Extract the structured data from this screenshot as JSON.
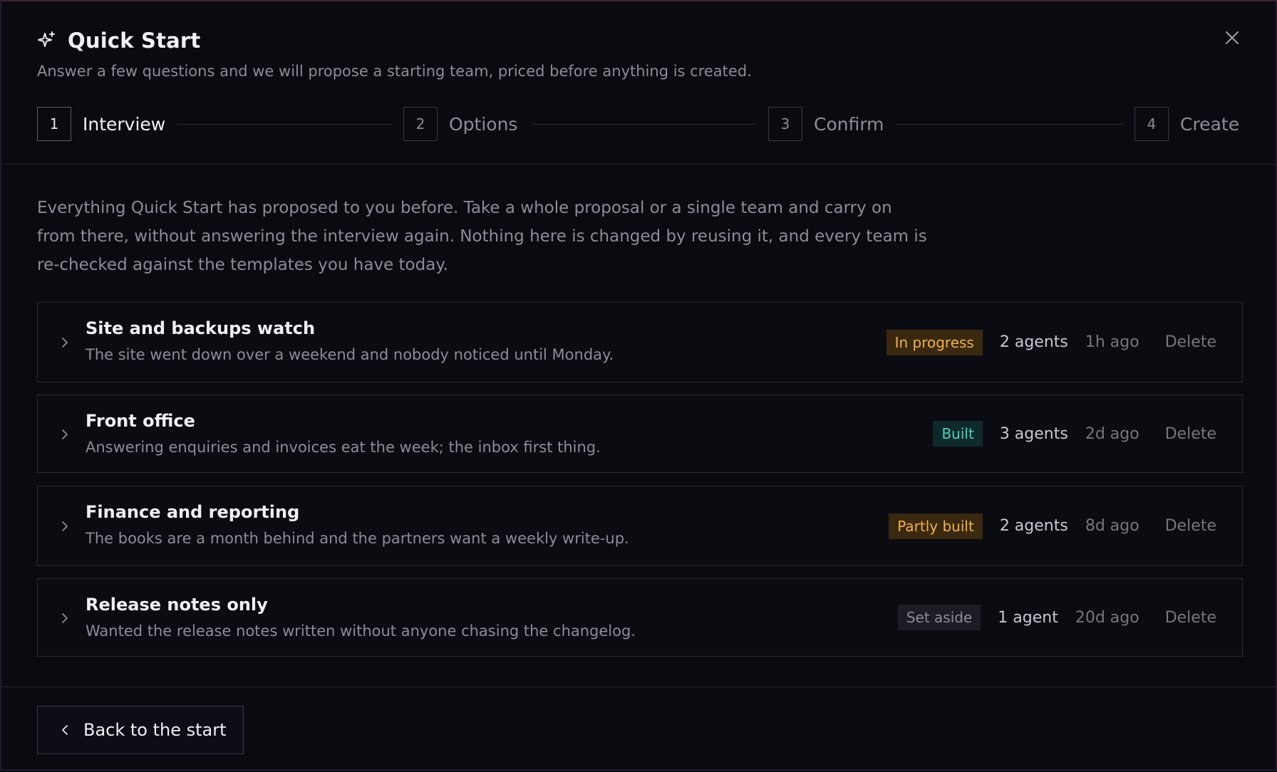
{
  "dialog": {
    "title": "Quick Start",
    "subtitle": "Answer a few questions and we will propose a starting team, priced before anything is created.",
    "title_icon": "sparkle-icon",
    "close_icon": "close-icon"
  },
  "steps": [
    {
      "number": "1",
      "label": "Interview",
      "active": true
    },
    {
      "number": "2",
      "label": "Options",
      "active": false
    },
    {
      "number": "3",
      "label": "Confirm",
      "active": false
    },
    {
      "number": "4",
      "label": "Create",
      "active": false
    }
  ],
  "intro": "Everything Quick Start has proposed to you before. Take a whole proposal or a single team and carry on from there, without answering the interview again. Nothing here is changed by reusing it, and every team is re-checked against the templates you have today.",
  "proposals": [
    {
      "title": "Site and backups watch",
      "description": "The site went down over a weekend and nobody noticed until Monday.",
      "status": "In progress",
      "status_kind": "progress",
      "agents": "2 agents",
      "age": "1h ago",
      "delete_label": "Delete"
    },
    {
      "title": "Front office",
      "description": "Answering enquiries and invoices eat the week; the inbox first thing.",
      "status": "Built",
      "status_kind": "built",
      "agents": "3 agents",
      "age": "2d ago",
      "delete_label": "Delete"
    },
    {
      "title": "Finance and reporting",
      "description": "The books are a month behind and the partners want a weekly write-up.",
      "status": "Partly built",
      "status_kind": "partial",
      "agents": "2 agents",
      "age": "8d ago",
      "delete_label": "Delete"
    },
    {
      "title": "Release notes only",
      "description": "Wanted the release notes written without anyone chasing the changelog.",
      "status": "Set aside",
      "status_kind": "aside",
      "agents": "1 agent",
      "age": "20d ago",
      "delete_label": "Delete"
    }
  ],
  "status_colors": {
    "progress": {
      "fg": "#f0b24a",
      "bg": "#3a2810"
    },
    "built": {
      "fg": "#4fd1c5",
      "bg": "#0f2a2a"
    },
    "partial": {
      "fg": "#f0b24a",
      "bg": "#3a2810"
    },
    "aside": {
      "fg": "#8d8c98",
      "bg": "#1c1c24"
    }
  },
  "footer": {
    "back_label": "Back to the start",
    "back_icon": "chevron-left-icon"
  }
}
